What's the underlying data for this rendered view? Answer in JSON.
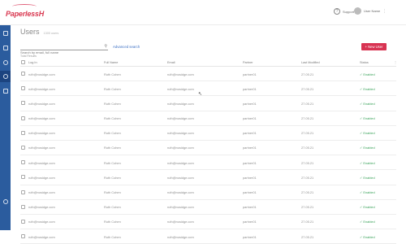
{
  "app": {
    "logo_text": "PaperlessH",
    "help_label": "Support",
    "user_name": "User Name"
  },
  "page": {
    "title": "Users",
    "count": "1300 users",
    "new_button": "+ New User",
    "search_placeholder": "Search by email, full name",
    "advanced_search": "Advanced search",
    "total_label": "Total Results"
  },
  "table": {
    "columns": [
      "Log In",
      "Full Name",
      "Email",
      "Partner",
      "Last Modified",
      "Status"
    ],
    "rows": [
      {
        "login": "ruth@nosidge.com",
        "name": "Ruth Cohen",
        "email": "ruth@nosidge.com",
        "partner": "partner01",
        "modified": "27.05.21",
        "status": "Enabled"
      },
      {
        "login": "ruth@nosidge.com",
        "name": "Ruth Cohen",
        "email": "ruth@nosidge.com",
        "partner": "partner01",
        "modified": "27.05.21",
        "status": "Enabled"
      },
      {
        "login": "ruth@nosidge.com",
        "name": "Ruth Cohen",
        "email": "ruth@nosidge.com",
        "partner": "partner01",
        "modified": "27.05.21",
        "status": "Enabled"
      },
      {
        "login": "ruth@nosidge.com",
        "name": "Ruth Cohen",
        "email": "ruth@nosidge.com",
        "partner": "partner01",
        "modified": "27.05.21",
        "status": "Enabled"
      },
      {
        "login": "ruth@nosidge.com",
        "name": "Ruth Cohen",
        "email": "ruth@nosidge.com",
        "partner": "partner01",
        "modified": "27.05.21",
        "status": "Enabled"
      },
      {
        "login": "ruth@nosidge.com",
        "name": "Ruth Cohen",
        "email": "ruth@nosidge.com",
        "partner": "partner01",
        "modified": "27.05.21",
        "status": "Enabled"
      },
      {
        "login": "ruth@nosidge.com",
        "name": "Ruth Cohen",
        "email": "ruth@nosidge.com",
        "partner": "partner01",
        "modified": "27.05.21",
        "status": "Enabled"
      },
      {
        "login": "ruth@nosidge.com",
        "name": "Ruth Cohen",
        "email": "ruth@nosidge.com",
        "partner": "partner01",
        "modified": "27.05.21",
        "status": "Enabled"
      },
      {
        "login": "ruth@nosidge.com",
        "name": "Ruth Cohen",
        "email": "ruth@nosidge.com",
        "partner": "partner01",
        "modified": "27.05.21",
        "status": "Enabled"
      },
      {
        "login": "ruth@nosidge.com",
        "name": "Ruth Cohen",
        "email": "ruth@nosidge.com",
        "partner": "partner01",
        "modified": "27.05.21",
        "status": "Enabled"
      },
      {
        "login": "ruth@nosidge.com",
        "name": "Ruth Cohen",
        "email": "ruth@nosidge.com",
        "partner": "partner01",
        "modified": "27.05.21",
        "status": "Enabled"
      },
      {
        "login": "ruth@nosidge.com",
        "name": "Ruth Cohen",
        "email": "ruth@nosidge.com",
        "partner": "partner01",
        "modified": "27.05.21",
        "status": "Enabled"
      }
    ]
  },
  "colors": {
    "sidebar": "#2b5c9e",
    "accent": "#d83352",
    "status_enabled": "#3aa35a",
    "link": "#3b6fc4"
  },
  "icons": {
    "sidebar": [
      "list-icon",
      "home-icon",
      "settings-icon",
      "user-icon",
      "id-card-icon",
      "gear-icon"
    ],
    "search": "search-icon",
    "help": "help-icon",
    "status": "check-icon"
  }
}
